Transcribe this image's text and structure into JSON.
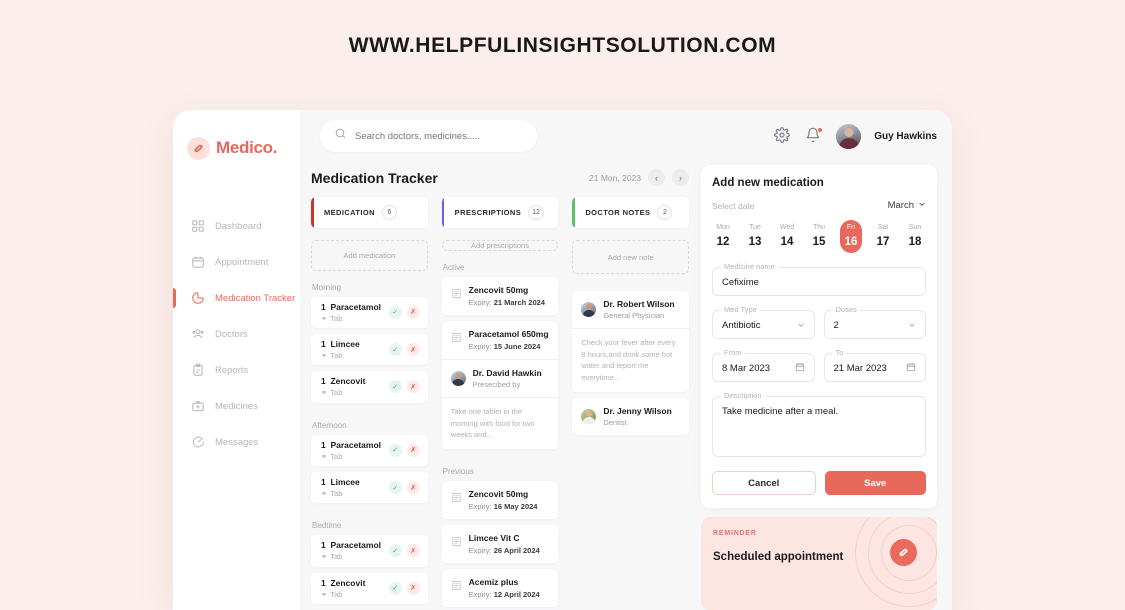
{
  "watermark": "WWW.HELPFULINSIGHTSOLUTION.COM",
  "brand": {
    "name": "Medico.",
    "accent": "#e8695c",
    "logo_icon": "pill-icon"
  },
  "sidebar": {
    "items": [
      {
        "label": "Dashboard",
        "icon": "grid-icon",
        "active": false
      },
      {
        "label": "Appointment",
        "icon": "calendar-icon",
        "active": false
      },
      {
        "label": "Medication Tracker",
        "icon": "pie-chart-icon",
        "active": true
      },
      {
        "label": "Doctors",
        "icon": "users-icon",
        "active": false
      },
      {
        "label": "Reports",
        "icon": "clipboard-icon",
        "active": false
      },
      {
        "label": "Medicines",
        "icon": "medkit-icon",
        "active": false
      },
      {
        "label": "Messages",
        "icon": "chat-icon",
        "active": false
      }
    ]
  },
  "topbar": {
    "search_placeholder": "Search doctors, medicines.....",
    "search_value": "",
    "settings_icon": "gear-icon",
    "notification_icon": "bell-icon",
    "username": "Guy Hawkins"
  },
  "page": {
    "title": "Medication Tracker",
    "date_label": "21 Mon, 2023",
    "prev_icon": "chevron-left-icon",
    "next_icon": "chevron-right-icon"
  },
  "tabs": [
    {
      "label": "MEDICATION",
      "count": "6",
      "color": "#c0392b"
    },
    {
      "label": "PRESCRIPTIONS",
      "count": "12",
      "color": "#6c5ce7"
    },
    {
      "label": "DOCTOR NOTES",
      "count": "2",
      "color": "#5ec06a"
    }
  ],
  "columns": {
    "medication": {
      "add_label": "Add medication",
      "groups": [
        {
          "title": "Morning",
          "rows": [
            {
              "qty": "1",
              "name": "Paracetamol",
              "form": "Tab"
            },
            {
              "qty": "1",
              "name": "Limcee",
              "form": "Tab"
            },
            {
              "qty": "1",
              "name": "Zencovit",
              "form": "Tab"
            }
          ]
        },
        {
          "title": "Afternoon",
          "rows": [
            {
              "qty": "1",
              "name": "Paracetamol",
              "form": "Tab"
            },
            {
              "qty": "1",
              "name": "Limcee",
              "form": "Tab"
            }
          ]
        },
        {
          "title": "Bedtime",
          "rows": [
            {
              "qty": "1",
              "name": "Paracetamol",
              "form": "Tab"
            },
            {
              "qty": "1",
              "name": "Zencovit",
              "form": "Tab"
            }
          ]
        }
      ]
    },
    "prescriptions": {
      "add_label": "Add prescriptions",
      "active_title": "Active",
      "active": [
        {
          "name": "Zencovit 50mg",
          "expiry_label": "Expiry:",
          "expiry_value": "21 March 2024"
        },
        {
          "name": "Paracetamol 650mg",
          "expiry_label": "Expiry:",
          "expiry_value": "15 June 2024"
        }
      ],
      "doctor_card": {
        "name": "Dr. David Hawkin",
        "role": "Presecibed by",
        "note": "Take one tablet in the morning with food for two weeks and..."
      },
      "previous_title": "Previous",
      "previous": [
        {
          "name": "Zencovit 50mg",
          "expiry_label": "Expiry:",
          "expiry_value": "16 May 2024"
        },
        {
          "name": "Limcee Vit C",
          "expiry_label": "Expiry:",
          "expiry_value": "26 April 2024"
        },
        {
          "name": "Acemiz plus",
          "expiry_label": "Expiry:",
          "expiry_value": "12 April 2024"
        }
      ]
    },
    "notes": {
      "add_label": "Add new note",
      "cards": [
        {
          "name": "Dr. Robert Wilson",
          "role": "General Physician",
          "note": "Check your fever after every 8 hours,and drink some hot water and report me everytime..."
        },
        {
          "name": "Dr. Jenny Wilson",
          "role": "Dentist",
          "note": ""
        }
      ]
    }
  },
  "add_medication": {
    "title": "Add new medication",
    "select_date_label": "Select date",
    "month": "March",
    "month_chevron_icon": "chevron-down-icon",
    "days": [
      {
        "name": "Mon",
        "num": "12",
        "selected": false
      },
      {
        "name": "Tue",
        "num": "13",
        "selected": false
      },
      {
        "name": "Wed",
        "num": "14",
        "selected": false
      },
      {
        "name": "Thu",
        "num": "15",
        "selected": false
      },
      {
        "name": "Fri",
        "num": "16",
        "selected": true
      },
      {
        "name": "Sat",
        "num": "17",
        "selected": false
      },
      {
        "name": "Sun",
        "num": "18",
        "selected": false
      }
    ],
    "medicine_name": {
      "label": "Medicine name",
      "value": "Cefixime"
    },
    "med_type": {
      "label": "Med Type",
      "value": "Antibiotic",
      "icon": "chevron-down-icon"
    },
    "doses": {
      "label": "Doses",
      "value": "2",
      "icon": "chevron-down-icon"
    },
    "from": {
      "label": "From",
      "value": "8 Mar 2023",
      "icon": "calendar-icon"
    },
    "to": {
      "label": "To",
      "value": "21 Mar 2023",
      "icon": "calendar-icon"
    },
    "description": {
      "label": "Description",
      "value": "Take medicine after a meal."
    },
    "cancel_label": "Cancel",
    "save_label": "Save"
  },
  "reminder": {
    "kicker": "REMINDER",
    "title": "Scheduled appointment",
    "badge_icon": "pill-icon"
  }
}
